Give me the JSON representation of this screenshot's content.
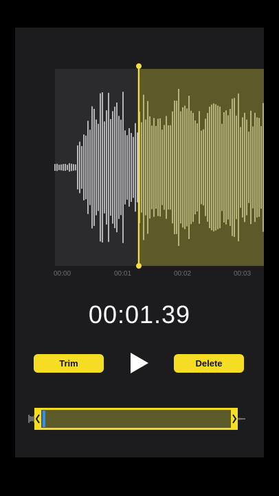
{
  "timeline": {
    "ticks": [
      "00:00",
      "00:01",
      "00:02",
      "00:03"
    ]
  },
  "playback": {
    "current_time": "00:01.39"
  },
  "controls": {
    "trim_label": "Trim",
    "delete_label": "Delete"
  },
  "colors": {
    "accent": "#f4dd22",
    "selection": "#5d5a2a",
    "cursor": "#2f8ff2"
  },
  "icons": {
    "play": "play-icon",
    "left_handle": "chevron-left-icon",
    "right_handle": "chevron-right-icon"
  }
}
